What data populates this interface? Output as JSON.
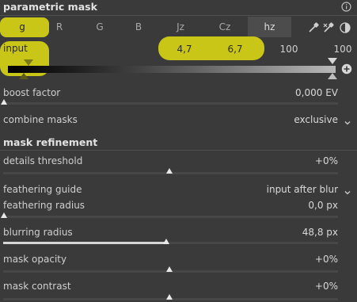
{
  "module": {
    "title": "parametric mask",
    "info_icon": "info-icon"
  },
  "channels": {
    "tabs": [
      "g",
      "R",
      "G",
      "B",
      "Jz",
      "Cz",
      "hz"
    ],
    "active": "g",
    "hovered": "hz"
  },
  "input": {
    "label": "input",
    "values": [
      "4,7",
      "6,7",
      "100",
      "100"
    ]
  },
  "colors": {
    "highlight": "#c9c617",
    "background": "#3a3a3a"
  },
  "boost_factor": {
    "label": "boost factor",
    "value": "0,000 EV"
  },
  "combine_masks": {
    "label": "combine masks",
    "value": "exclusive"
  },
  "refinement": {
    "title": "mask refinement",
    "details_threshold": {
      "label": "details threshold",
      "value": "+0%"
    },
    "feathering_guide": {
      "label": "feathering guide",
      "value": "input after blur"
    },
    "feathering_radius": {
      "label": "feathering radius",
      "value": "0,0 px"
    },
    "blurring_radius": {
      "label": "blurring radius",
      "value": "48,8 px"
    },
    "mask_opacity": {
      "label": "mask opacity",
      "value": "+0%"
    },
    "mask_contrast": {
      "label": "mask contrast",
      "value": "+0%"
    }
  }
}
